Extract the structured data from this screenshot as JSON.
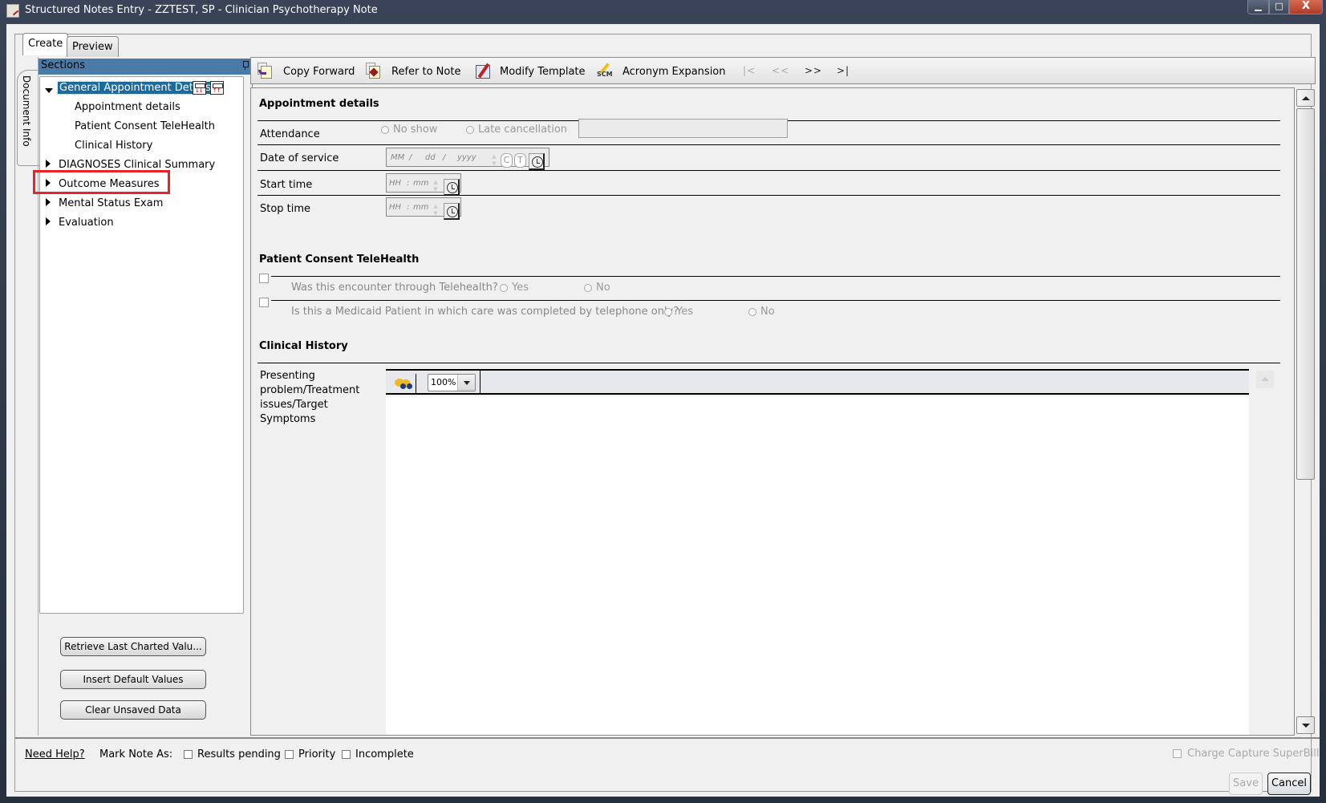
{
  "window": {
    "title": "Structured Notes Entry - ZZTEST, SP - Clinician Psychotherapy Note",
    "controls": {
      "minimize": "▁",
      "maximize": "□",
      "close": "X"
    }
  },
  "tabs": [
    {
      "label": "Create",
      "active": true
    },
    {
      "label": "Preview",
      "active": false
    }
  ],
  "side_tab": {
    "label": "Document Info"
  },
  "sections": {
    "header": "Sections",
    "items": [
      {
        "label": "General Appointment Details",
        "expanded": true,
        "selected": true,
        "children": [
          "Appointment details",
          "Patient Consent TeleHealth",
          "Clinical History"
        ]
      },
      {
        "label": "DIAGNOSES Clinical Summary",
        "expanded": false
      },
      {
        "label": "Outcome Measures",
        "expanded": false,
        "highlighted": true
      },
      {
        "label": "Mental Status Exam",
        "expanded": false
      },
      {
        "label": "Evaluation",
        "expanded": false
      }
    ],
    "highlight_color": "#e8232a"
  },
  "left_buttons": {
    "retrieve": "Retrieve  Last  Charted Valu...",
    "insert_default": "Insert Default Values",
    "clear_unsaved": "Clear Unsaved Data"
  },
  "toolbar": {
    "copy_forward": "Copy Forward",
    "refer_to_note": "Refer to Note",
    "modify_template": "Modify Template",
    "acronym_expansion": "Acronym Expansion",
    "acronym_icon_text": "SCM",
    "nav_first": "|<",
    "nav_prev": "<<",
    "nav_next": ">>",
    "nav_last": ">|"
  },
  "appointment_details": {
    "title": "Appointment details",
    "attendance_label": "Attendance",
    "attendance_options": [
      "No show",
      "Late cancellation"
    ],
    "date_label": "Date of service",
    "date_placeholder": {
      "mm": "MM",
      "dd": "dd",
      "yyyy": "yyyy",
      "sep": "/"
    },
    "date_buttons": {
      "c": "C",
      "t": "T"
    },
    "start_label": "Start time",
    "stop_label": "Stop time",
    "time_placeholder": {
      "hh": "HH",
      "mm": "mm",
      "sep": ":"
    }
  },
  "telehealth": {
    "title": "Patient Consent TeleHealth",
    "q1": "Was this encounter through Telehealth?",
    "q2": "Is this a Medicaid Patient in which care was completed by telephone only?",
    "yes": "Yes",
    "no": "No"
  },
  "clinical_history": {
    "title": "Clinical History",
    "field_label": "Presenting problem/Treatment issues/Target Symptoms",
    "zoom_value": "100%"
  },
  "footer": {
    "help": "Need Help?",
    "mark_note_as": "Mark Note As:",
    "marks": [
      "Results pending",
      "Priority",
      "Incomplete"
    ],
    "charge_capture": "Charge Capture SuperBill",
    "save": "Save",
    "cancel": "Cancel"
  }
}
